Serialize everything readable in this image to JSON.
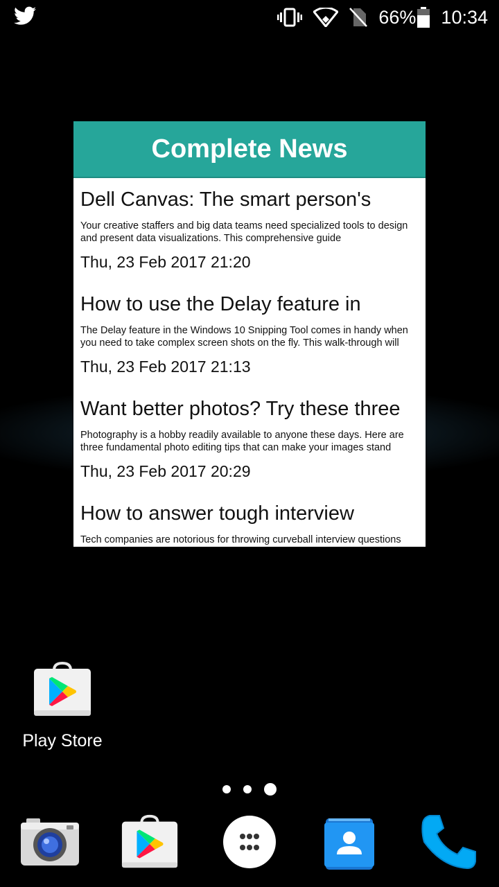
{
  "status_bar": {
    "left_icons": [
      "twitter-icon"
    ],
    "right_icons": [
      "vibrate-icon",
      "wifi-icon",
      "no-sim-icon",
      "battery-icon"
    ],
    "battery": "66%",
    "time": "10:34"
  },
  "widget": {
    "title": "Complete News",
    "accent_color": "#26a69a",
    "items": [
      {
        "headline": "Dell Canvas: The smart person's",
        "summary": "Your creative staffers and big data teams need specialized tools to design and present data visualizations. This comprehensive guide",
        "date": "Thu, 23 Feb 2017 21:20"
      },
      {
        "headline": "How to use the Delay feature in",
        "summary": "The Delay feature in the Windows 10 Snipping Tool comes in handy when you need to take complex screen shots on the fly. This walk-through will",
        "date": "Thu, 23 Feb 2017 21:13"
      },
      {
        "headline": "Want better photos? Try these three",
        "summary": "Photography is a hobby readily available to anyone these days. Here are three fundamental photo editing tips that can make your images stand",
        "date": "Thu, 23 Feb 2017 20:29"
      },
      {
        "headline": "How to answer tough interview",
        "summary": "Tech companies are notorious for throwing curveball interview questions",
        "date": ""
      }
    ]
  },
  "desktop": {
    "apps": [
      {
        "label": "Play Store",
        "icon": "play-store-icon"
      }
    ]
  },
  "page_indicator": {
    "count": 3,
    "active": 3
  },
  "dock": {
    "apps": [
      "camera-icon",
      "play-store-icon",
      "app-drawer-icon",
      "contacts-icon",
      "phone-icon"
    ]
  }
}
